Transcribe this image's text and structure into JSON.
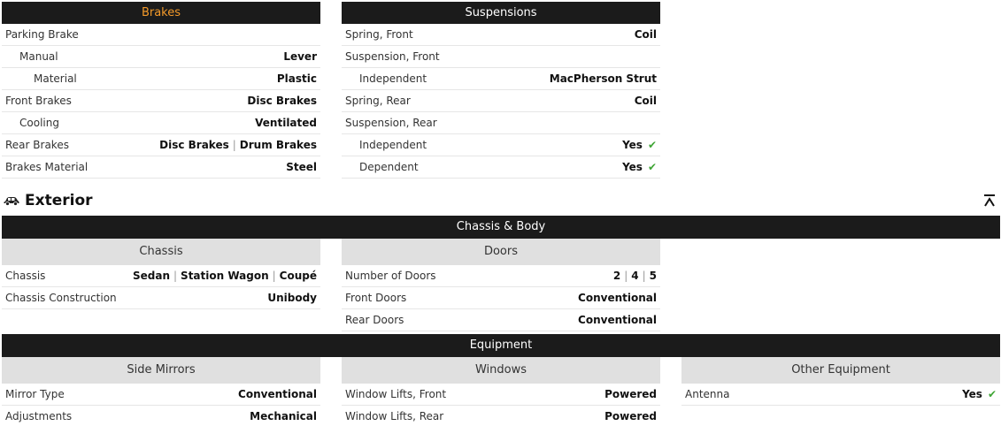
{
  "brakes": {
    "title": "Brakes",
    "rows": [
      {
        "label": "Parking Brake",
        "values": []
      },
      {
        "label": "Manual",
        "values": [
          "Lever"
        ]
      },
      {
        "label": "Material",
        "values": [
          "Plastic"
        ]
      },
      {
        "label": "Front Brakes",
        "values": [
          "Disc Brakes"
        ]
      },
      {
        "label": "Cooling",
        "values": [
          "Ventilated"
        ]
      },
      {
        "label": "Rear Brakes",
        "values": [
          "Disc Brakes",
          "Drum Brakes"
        ]
      },
      {
        "label": "Brakes Material",
        "values": [
          "Steel"
        ]
      }
    ]
  },
  "suspensions": {
    "title": "Suspensions",
    "rows": [
      {
        "label": "Spring, Front",
        "values": [
          "Coil"
        ]
      },
      {
        "label": "Suspension, Front",
        "values": []
      },
      {
        "label": "Independent",
        "values": [
          "MacPherson Strut"
        ]
      },
      {
        "label": "Spring, Rear",
        "values": [
          "Coil"
        ]
      },
      {
        "label": "Suspension, Rear",
        "values": []
      },
      {
        "label": "Independent",
        "values": [
          "Yes"
        ],
        "check": true
      },
      {
        "label": "Dependent",
        "values": [
          "Yes"
        ],
        "check": true
      }
    ]
  },
  "exterior": {
    "title": "Exterior",
    "icon": "car-icon",
    "collapse_icon": "collapse-up-icon"
  },
  "chassis_body": {
    "title": "Chassis & Body",
    "chassis": {
      "title": "Chassis",
      "rows": [
        {
          "label": "Chassis",
          "values": [
            "Sedan",
            "Station Wagon",
            "Coupé"
          ]
        },
        {
          "label": "Chassis Construction",
          "values": [
            "Unibody"
          ]
        }
      ]
    },
    "doors": {
      "title": "Doors",
      "rows": [
        {
          "label": "Number of Doors",
          "values": [
            "2",
            "4",
            "5"
          ]
        },
        {
          "label": "Front Doors",
          "values": [
            "Conventional"
          ]
        },
        {
          "label": "Rear Doors",
          "values": [
            "Conventional"
          ]
        }
      ]
    }
  },
  "equipment": {
    "title": "Equipment",
    "side_mirrors": {
      "title": "Side Mirrors",
      "rows": [
        {
          "label": "Mirror Type",
          "values": [
            "Conventional"
          ]
        },
        {
          "label": "Adjustments",
          "values": [
            "Mechanical"
          ]
        }
      ]
    },
    "windows": {
      "title": "Windows",
      "rows": [
        {
          "label": "Window Lifts, Front",
          "values": [
            "Powered"
          ]
        },
        {
          "label": "Window Lifts, Rear",
          "values": [
            "Powered"
          ]
        }
      ]
    },
    "other": {
      "title": "Other Equipment",
      "rows": [
        {
          "label": "Antenna",
          "values": [
            "Yes"
          ],
          "check": true
        }
      ]
    }
  }
}
